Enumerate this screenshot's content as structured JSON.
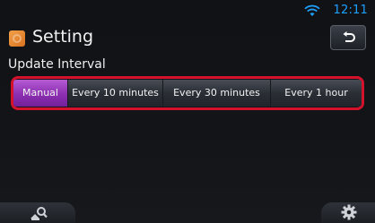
{
  "status_bar": {
    "time": "12:11",
    "icons": [
      "wifi-icon"
    ],
    "time_color": "#1fa1ff"
  },
  "header": {
    "title": "Setting",
    "icons": [
      "setting-app-icon",
      "back-arrow-icon"
    ]
  },
  "section": {
    "label": "Update Interval"
  },
  "interval_options": {
    "selected_index": 0,
    "items": [
      {
        "label": "Manual"
      },
      {
        "label": "Every 10 minutes"
      },
      {
        "label": "Every 30 minutes"
      },
      {
        "label": "Every 1 hour"
      }
    ]
  },
  "bottom_bar": {
    "icons": [
      "map-search-icon",
      "gear-icon"
    ]
  },
  "colors": {
    "highlight_border": "#d5122b",
    "selected_option": "#8b2fb0",
    "accent_blue": "#1fa1ff",
    "title_icon": "#e98a32"
  }
}
